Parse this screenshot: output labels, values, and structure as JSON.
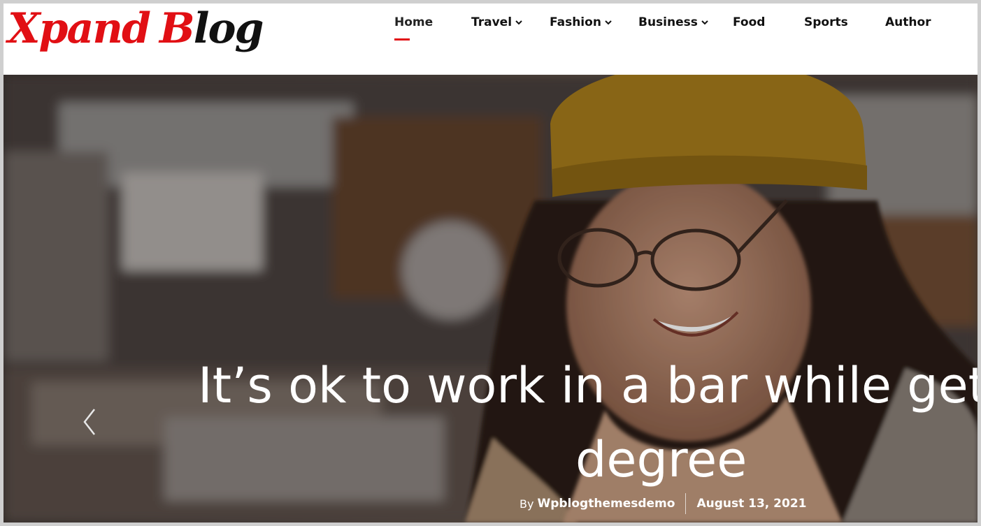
{
  "header": {
    "logo": {
      "part1": "Xpand",
      "part2": "B",
      "part3": "log"
    },
    "nav": [
      {
        "label": "Home",
        "active": true,
        "dropdown": false
      },
      {
        "label": "Travel",
        "active": false,
        "dropdown": true
      },
      {
        "label": "Fashion",
        "active": false,
        "dropdown": true
      },
      {
        "label": "Business",
        "active": false,
        "dropdown": true
      },
      {
        "label": "Food",
        "active": false,
        "dropdown": false
      },
      {
        "label": "Sports",
        "active": false,
        "dropdown": false
      },
      {
        "label": "Author",
        "active": false,
        "dropdown": false
      }
    ]
  },
  "hero": {
    "title_line1": "It’s ok to work in a bar while get",
    "title_line2": "degree",
    "by_label": "By",
    "author": "Wpblogthemesdemo",
    "date": "August 13, 2021",
    "prev_icon": "chevron-left-icon"
  },
  "colors": {
    "accent": "#e10f14",
    "text": "#111111",
    "hero_text": "#ffffff"
  }
}
